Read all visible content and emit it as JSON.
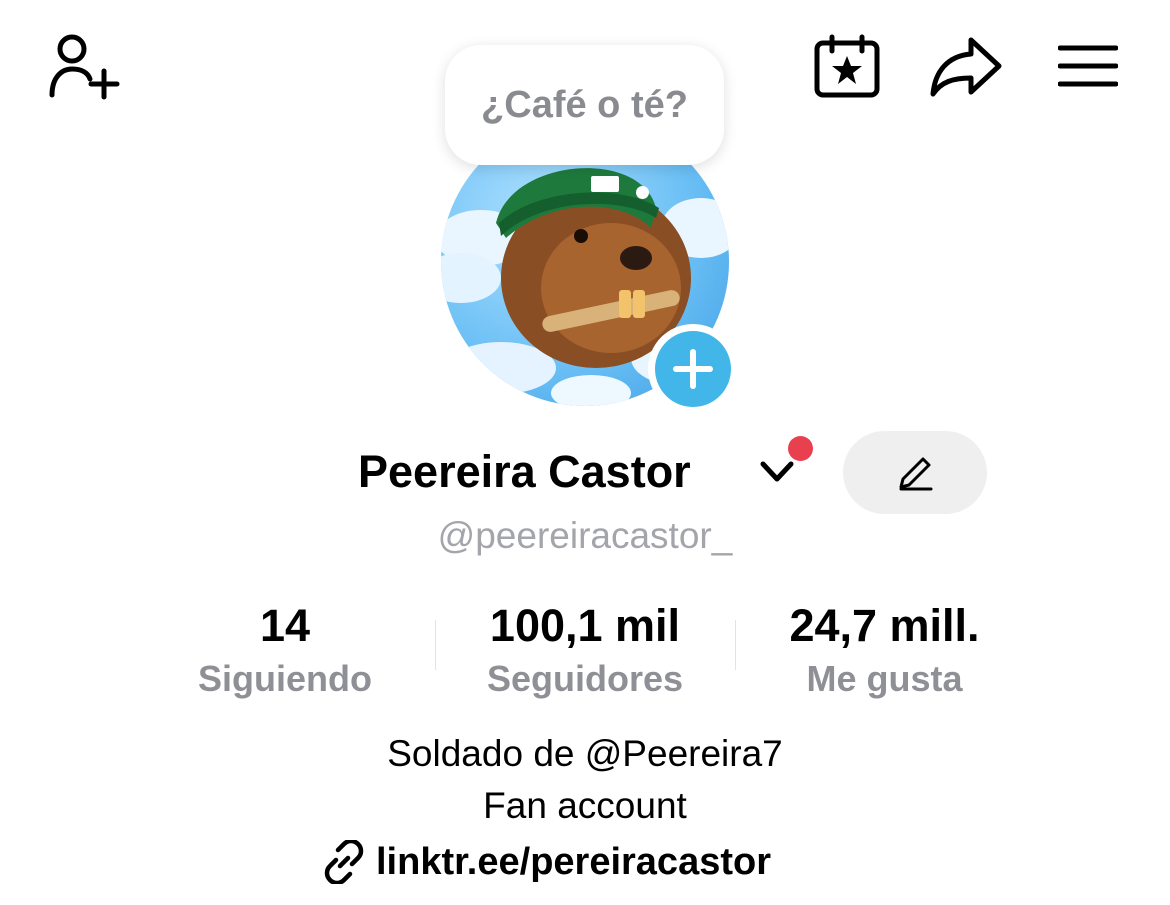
{
  "header": {
    "add_friend_icon": "person-plus-icon",
    "events_icon": "calendar-star-icon",
    "share_icon": "share-arrow-icon",
    "menu_icon": "hamburger-menu-icon"
  },
  "bubble": {
    "text": "¿Café o té?"
  },
  "profile": {
    "avatar_description": "beaver-avatar",
    "add_photo_icon": "plus-icon",
    "display_name": "Peereira Castor",
    "username": "@peereiracastor_",
    "edit_icon": "pencil-icon",
    "notification_dot_color": "#e8404f"
  },
  "stats": {
    "following": {
      "value": "14",
      "label": "Siguiendo"
    },
    "followers": {
      "value": "100,1 mil",
      "label": "Seguidores"
    },
    "likes": {
      "value": "24,7 mill.",
      "label": "Me gusta"
    }
  },
  "bio": {
    "line1": "Soldado de @Peereira7",
    "line2": "Fan account",
    "link": "linktr.ee/pereiracastor",
    "link_icon": "link-icon"
  },
  "colors": {
    "accent": "#42b6e9",
    "muted_text": "#8f9095",
    "edit_button_bg": "#efefef"
  }
}
